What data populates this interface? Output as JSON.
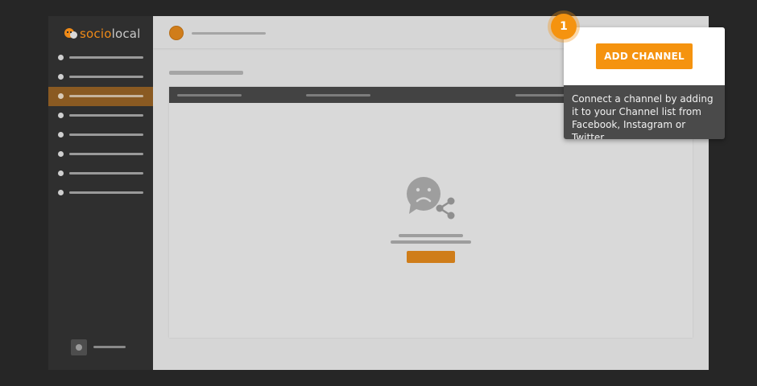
{
  "brand": {
    "name_part1": "socio",
    "name_part2": "local"
  },
  "sidebar": {
    "items": [
      {
        "active": false
      },
      {
        "active": false
      },
      {
        "active": true
      },
      {
        "active": false
      },
      {
        "active": false
      },
      {
        "active": false
      },
      {
        "active": false
      },
      {
        "active": false
      }
    ]
  },
  "onboarding": {
    "step_number": "1",
    "add_button_label": "ADD CHANNEL",
    "description": "Connect a channel by adding it to your Channel list from Facebook, Instagram or Twitter."
  },
  "colors": {
    "accent": "#f5930f",
    "sidebar_bg": "#2f2f2f",
    "active_item_bg": "#8a5a22",
    "page_bg": "#262626",
    "tooltip_bg": "#4a4a4a"
  },
  "icons": {
    "empty_state": "sad-face-share-icon",
    "logo": "chat-bubble-logo-icon"
  }
}
